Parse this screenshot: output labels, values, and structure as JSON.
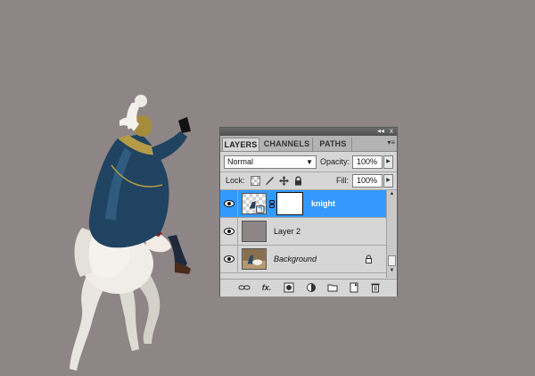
{
  "panel": {
    "tabs": [
      "LAYERS",
      "CHANNELS",
      "PATHS"
    ],
    "active_tab": "LAYERS",
    "collapse_glyph": "◂◂",
    "close_glyph": "x",
    "menu_glyph": "▾≡",
    "blend_mode": "Normal",
    "opacity_label": "Opacity:",
    "opacity_value": "100%",
    "lock_label": "Lock:",
    "fill_label": "Fill:",
    "fill_value": "100%",
    "layers": [
      {
        "name": "knight",
        "selected": true,
        "has_mask": true
      },
      {
        "name": "Layer 2",
        "selected": false
      },
      {
        "name": "Background",
        "selected": false,
        "locked": true
      }
    ],
    "bottom_icons": [
      "link-layers-icon",
      "fx-icon",
      "add-mask-icon",
      "adjustment-layer-icon",
      "group-folder-icon",
      "new-layer-icon",
      "trash-icon"
    ],
    "fx_text": "fx."
  },
  "colors": {
    "canvas_bg": "#8d8586",
    "selected_row": "#3399ff",
    "panel_bg": "#d6d6d6"
  }
}
